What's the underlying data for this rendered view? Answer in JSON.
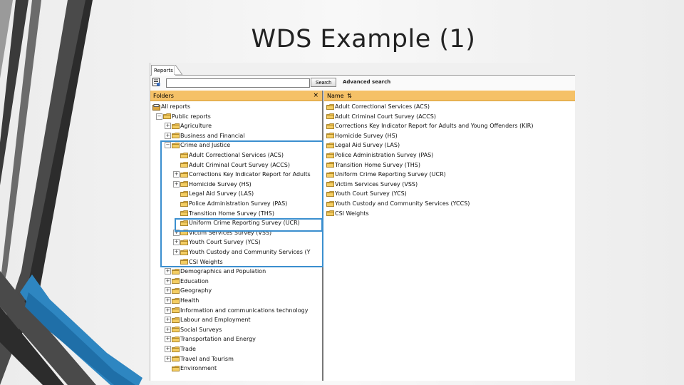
{
  "slide": {
    "title": "WDS Example (1)"
  },
  "colors": {
    "accent_blue": "#3b8fcf",
    "header_orange": "#f5c167",
    "dark_gray": "#4a4a4a"
  },
  "app": {
    "tab_label": "Reports",
    "search": {
      "value": "",
      "button_label": "Search",
      "advanced_label": "Advanced search"
    },
    "folders_pane": {
      "title": "Folders",
      "close_glyph": "×",
      "items": [
        {
          "label": "All reports",
          "indent": 0,
          "toggle": "",
          "icon": "all-reports"
        },
        {
          "label": "Public reports",
          "indent": 1,
          "toggle": "−",
          "icon": "folder"
        },
        {
          "label": "Agriculture",
          "indent": 2,
          "toggle": "+",
          "icon": "folder"
        },
        {
          "label": "Business and Financial",
          "indent": 2,
          "toggle": "+",
          "icon": "folder"
        },
        {
          "label": "Crime and Justice",
          "indent": 2,
          "toggle": "−",
          "icon": "folder"
        },
        {
          "label": "Adult Correctional Services (ACS)",
          "indent": 3,
          "toggle": "",
          "icon": "folder"
        },
        {
          "label": "Adult Criminal Court Survey (ACCS)",
          "indent": 3,
          "toggle": "",
          "icon": "folder"
        },
        {
          "label": "Corrections Key Indicator Report for Adults",
          "indent": 3,
          "toggle": "+",
          "icon": "folder"
        },
        {
          "label": "Homicide Survey (HS)",
          "indent": 3,
          "toggle": "+",
          "icon": "folder"
        },
        {
          "label": "Legal Aid Survey (LAS)",
          "indent": 3,
          "toggle": "",
          "icon": "folder"
        },
        {
          "label": "Police Administration Survey (PAS)",
          "indent": 3,
          "toggle": "",
          "icon": "folder"
        },
        {
          "label": "Transition Home Survey (THS)",
          "indent": 3,
          "toggle": "",
          "icon": "folder"
        },
        {
          "label": "Uniform Crime Reporting Survey (UCR)",
          "indent": 3,
          "toggle": "",
          "icon": "folder"
        },
        {
          "label": "Victim Services Survey (VSS)",
          "indent": 3,
          "toggle": "+",
          "icon": "folder"
        },
        {
          "label": "Youth Court Survey (YCS)",
          "indent": 3,
          "toggle": "+",
          "icon": "folder"
        },
        {
          "label": "Youth Custody and Community Services (Y",
          "indent": 3,
          "toggle": "+",
          "icon": "folder"
        },
        {
          "label": "CSI Weights",
          "indent": 3,
          "toggle": "",
          "icon": "folder"
        },
        {
          "label": "Demographics and Population",
          "indent": 2,
          "toggle": "+",
          "icon": "folder"
        },
        {
          "label": "Education",
          "indent": 2,
          "toggle": "+",
          "icon": "folder"
        },
        {
          "label": "Geography",
          "indent": 2,
          "toggle": "+",
          "icon": "folder"
        },
        {
          "label": "Health",
          "indent": 2,
          "toggle": "+",
          "icon": "folder"
        },
        {
          "label": "Information and communications technology",
          "indent": 2,
          "toggle": "+",
          "icon": "folder"
        },
        {
          "label": "Labour and Employment",
          "indent": 2,
          "toggle": "+",
          "icon": "folder"
        },
        {
          "label": "Social Surveys",
          "indent": 2,
          "toggle": "+",
          "icon": "folder"
        },
        {
          "label": "Transportation and Energy",
          "indent": 2,
          "toggle": "+",
          "icon": "folder"
        },
        {
          "label": "Trade",
          "indent": 2,
          "toggle": "+",
          "icon": "folder"
        },
        {
          "label": "Travel and Tourism",
          "indent": 2,
          "toggle": "+",
          "icon": "folder"
        },
        {
          "label": "Environment",
          "indent": 2,
          "toggle": "",
          "icon": "folder"
        }
      ]
    },
    "list_pane": {
      "header": "Name",
      "sort_glyph": "⇅",
      "items": [
        "Adult Correctional Services (ACS)",
        "Adult Criminal Court Survey (ACCS)",
        "Corrections Key Indicator Report for Adults and Young Offenders (KIR)",
        "Homicide Survey (HS)",
        "Legal Aid Survey (LAS)",
        "Police Administration Survey (PAS)",
        "Transition Home Survey (THS)",
        "Uniform Crime Reporting Survey (UCR)",
        "Victim Services Survey (VSS)",
        "Youth Court Survey (YCS)",
        "Youth Custody and Community Services (YCCS)",
        "CSI Weights"
      ]
    }
  }
}
